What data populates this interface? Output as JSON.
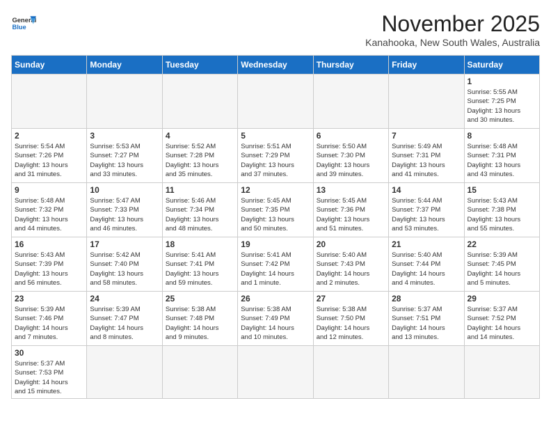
{
  "header": {
    "logo_general": "General",
    "logo_blue": "Blue",
    "month": "November 2025",
    "location": "Kanahooka, New South Wales, Australia"
  },
  "weekdays": [
    "Sunday",
    "Monday",
    "Tuesday",
    "Wednesday",
    "Thursday",
    "Friday",
    "Saturday"
  ],
  "weeks": [
    [
      {
        "day": "",
        "info": ""
      },
      {
        "day": "",
        "info": ""
      },
      {
        "day": "",
        "info": ""
      },
      {
        "day": "",
        "info": ""
      },
      {
        "day": "",
        "info": ""
      },
      {
        "day": "",
        "info": ""
      },
      {
        "day": "1",
        "info": "Sunrise: 5:55 AM\nSunset: 7:25 PM\nDaylight: 13 hours\nand 30 minutes."
      }
    ],
    [
      {
        "day": "2",
        "info": "Sunrise: 5:54 AM\nSunset: 7:26 PM\nDaylight: 13 hours\nand 31 minutes."
      },
      {
        "day": "3",
        "info": "Sunrise: 5:53 AM\nSunset: 7:27 PM\nDaylight: 13 hours\nand 33 minutes."
      },
      {
        "day": "4",
        "info": "Sunrise: 5:52 AM\nSunset: 7:28 PM\nDaylight: 13 hours\nand 35 minutes."
      },
      {
        "day": "5",
        "info": "Sunrise: 5:51 AM\nSunset: 7:29 PM\nDaylight: 13 hours\nand 37 minutes."
      },
      {
        "day": "6",
        "info": "Sunrise: 5:50 AM\nSunset: 7:30 PM\nDaylight: 13 hours\nand 39 minutes."
      },
      {
        "day": "7",
        "info": "Sunrise: 5:49 AM\nSunset: 7:31 PM\nDaylight: 13 hours\nand 41 minutes."
      },
      {
        "day": "8",
        "info": "Sunrise: 5:48 AM\nSunset: 7:31 PM\nDaylight: 13 hours\nand 43 minutes."
      }
    ],
    [
      {
        "day": "9",
        "info": "Sunrise: 5:48 AM\nSunset: 7:32 PM\nDaylight: 13 hours\nand 44 minutes."
      },
      {
        "day": "10",
        "info": "Sunrise: 5:47 AM\nSunset: 7:33 PM\nDaylight: 13 hours\nand 46 minutes."
      },
      {
        "day": "11",
        "info": "Sunrise: 5:46 AM\nSunset: 7:34 PM\nDaylight: 13 hours\nand 48 minutes."
      },
      {
        "day": "12",
        "info": "Sunrise: 5:45 AM\nSunset: 7:35 PM\nDaylight: 13 hours\nand 50 minutes."
      },
      {
        "day": "13",
        "info": "Sunrise: 5:45 AM\nSunset: 7:36 PM\nDaylight: 13 hours\nand 51 minutes."
      },
      {
        "day": "14",
        "info": "Sunrise: 5:44 AM\nSunset: 7:37 PM\nDaylight: 13 hours\nand 53 minutes."
      },
      {
        "day": "15",
        "info": "Sunrise: 5:43 AM\nSunset: 7:38 PM\nDaylight: 13 hours\nand 55 minutes."
      }
    ],
    [
      {
        "day": "16",
        "info": "Sunrise: 5:43 AM\nSunset: 7:39 PM\nDaylight: 13 hours\nand 56 minutes."
      },
      {
        "day": "17",
        "info": "Sunrise: 5:42 AM\nSunset: 7:40 PM\nDaylight: 13 hours\nand 58 minutes."
      },
      {
        "day": "18",
        "info": "Sunrise: 5:41 AM\nSunset: 7:41 PM\nDaylight: 13 hours\nand 59 minutes."
      },
      {
        "day": "19",
        "info": "Sunrise: 5:41 AM\nSunset: 7:42 PM\nDaylight: 14 hours\nand 1 minute."
      },
      {
        "day": "20",
        "info": "Sunrise: 5:40 AM\nSunset: 7:43 PM\nDaylight: 14 hours\nand 2 minutes."
      },
      {
        "day": "21",
        "info": "Sunrise: 5:40 AM\nSunset: 7:44 PM\nDaylight: 14 hours\nand 4 minutes."
      },
      {
        "day": "22",
        "info": "Sunrise: 5:39 AM\nSunset: 7:45 PM\nDaylight: 14 hours\nand 5 minutes."
      }
    ],
    [
      {
        "day": "23",
        "info": "Sunrise: 5:39 AM\nSunset: 7:46 PM\nDaylight: 14 hours\nand 7 minutes."
      },
      {
        "day": "24",
        "info": "Sunrise: 5:39 AM\nSunset: 7:47 PM\nDaylight: 14 hours\nand 8 minutes."
      },
      {
        "day": "25",
        "info": "Sunrise: 5:38 AM\nSunset: 7:48 PM\nDaylight: 14 hours\nand 9 minutes."
      },
      {
        "day": "26",
        "info": "Sunrise: 5:38 AM\nSunset: 7:49 PM\nDaylight: 14 hours\nand 10 minutes."
      },
      {
        "day": "27",
        "info": "Sunrise: 5:38 AM\nSunset: 7:50 PM\nDaylight: 14 hours\nand 12 minutes."
      },
      {
        "day": "28",
        "info": "Sunrise: 5:37 AM\nSunset: 7:51 PM\nDaylight: 14 hours\nand 13 minutes."
      },
      {
        "day": "29",
        "info": "Sunrise: 5:37 AM\nSunset: 7:52 PM\nDaylight: 14 hours\nand 14 minutes."
      }
    ],
    [
      {
        "day": "30",
        "info": "Sunrise: 5:37 AM\nSunset: 7:53 PM\nDaylight: 14 hours\nand 15 minutes."
      },
      {
        "day": "",
        "info": ""
      },
      {
        "day": "",
        "info": ""
      },
      {
        "day": "",
        "info": ""
      },
      {
        "day": "",
        "info": ""
      },
      {
        "day": "",
        "info": ""
      },
      {
        "day": "",
        "info": ""
      }
    ]
  ]
}
